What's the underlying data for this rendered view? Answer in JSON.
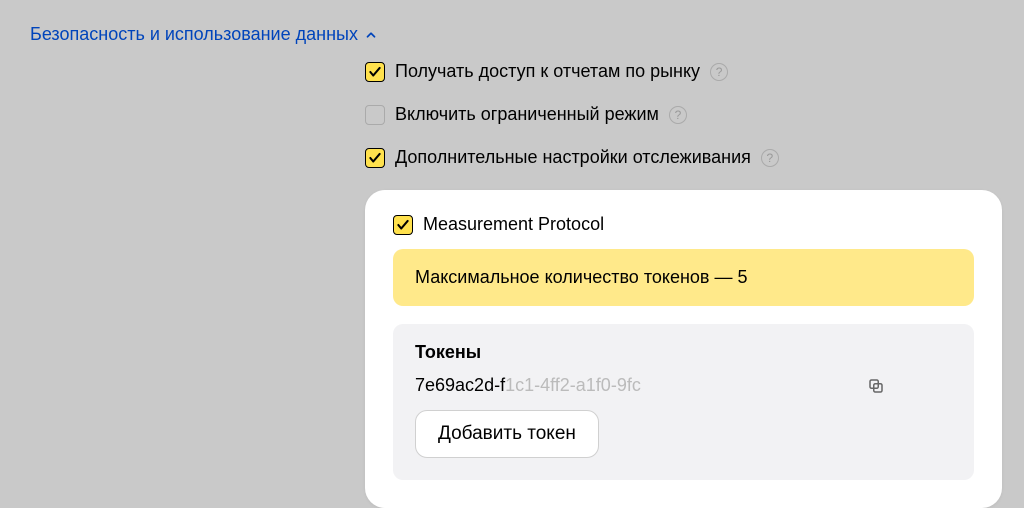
{
  "section": {
    "title": "Безопасность и использование данных"
  },
  "options": {
    "market_reports": {
      "label": "Получать доступ к отчетам по рынку",
      "checked": true
    },
    "limited_mode": {
      "label": "Включить ограниченный режим",
      "checked": false
    },
    "tracking_settings": {
      "label": "Дополнительные настройки отслеживания",
      "checked": true
    }
  },
  "measurement_protocol": {
    "label": "Measurement Protocol",
    "checked": true,
    "notice": "Максимальное количество токенов — 5",
    "tokens_title": "Токены",
    "token_visible": "7e69ac2d-f",
    "token_faded": "1c1-4ff2-a1f0-9fc",
    "add_button": "Добавить токен"
  }
}
